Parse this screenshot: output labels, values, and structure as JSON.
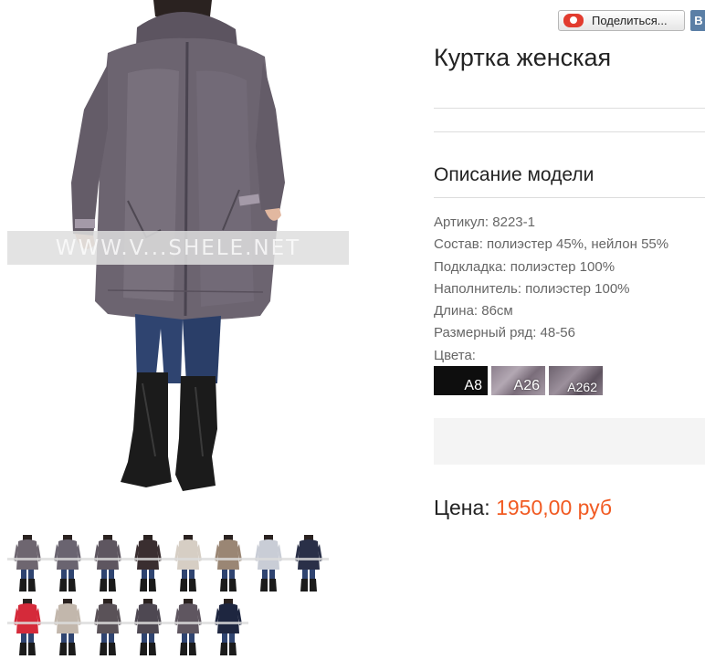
{
  "product": {
    "title": "Куртка женская",
    "watermark": "WWW.V...SHELE.NET"
  },
  "share": {
    "label": "Поделиться...",
    "vk_letter": "В"
  },
  "description": {
    "heading": "Описание модели",
    "lines": [
      "Артикул: 8223-1",
      "Состав: полиэстер 45%, нейлон 55%",
      "Подкладка: полиэстер 100%",
      "Наполнитель: полиэстер 100%",
      "Длина: 86см",
      "Размерный ряд: 48-56",
      "Цвета:"
    ]
  },
  "colors": [
    {
      "code": "A8",
      "hex": "#0e0e0e"
    },
    {
      "code": "A26",
      "hex": "#9c909c"
    },
    {
      "code": "A262",
      "hex": "#7a6e7a"
    }
  ],
  "price": {
    "label": "Цена:",
    "value": "1950,00 руб",
    "value_color": "#f15a22"
  },
  "thumbnails": {
    "row1": [
      "#6e6670",
      "#6a6470",
      "#5e5660",
      "#3a2e30",
      "#d6cec4",
      "#9a8674",
      "#c9cdd6",
      "#2a3048"
    ],
    "row2": [
      "#d52a3a",
      "#c2b7ac",
      "#5a5258",
      "#4e4852",
      "#5f5660",
      "#1e2640"
    ]
  },
  "theme": {
    "jacket_color": "#6c6470",
    "jeans_color": "#2f4470",
    "boots_color": "#1b1b1b",
    "accent_price": "#f15a22"
  }
}
